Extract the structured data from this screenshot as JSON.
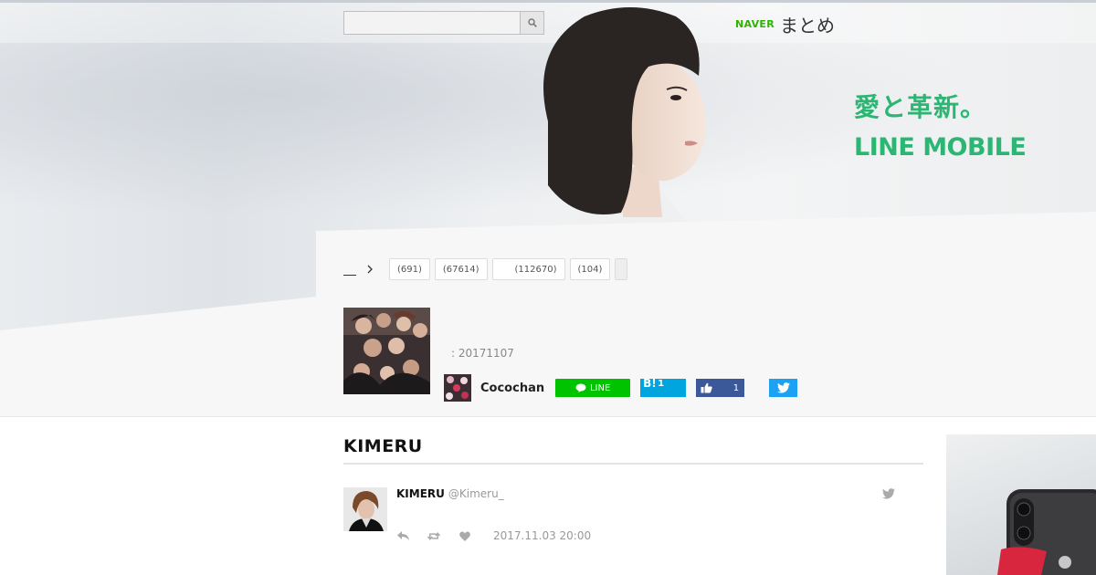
{
  "header": {
    "search": {
      "value": "",
      "placeholder": ""
    },
    "logo": {
      "brand": "NAVER",
      "service": "まとめ"
    }
  },
  "ad_banner": {
    "line1": "愛と革新。",
    "line2": "LINE MOBILE",
    "accent": "#2bb673"
  },
  "breadcrumb": {
    "home_label": "",
    "chips": [
      {
        "label": "(691)"
      },
      {
        "label": "(67614)"
      },
      {
        "label": "(112670)"
      },
      {
        "label": "(104)"
      }
    ]
  },
  "article": {
    "date_label": ": 20171107",
    "author": "Cocochan",
    "share": {
      "line_label": "LINE",
      "hatena_count": "1",
      "like_count": "1"
    }
  },
  "section": {
    "title": "KIMERU"
  },
  "tweet": {
    "name": "KIMERU",
    "handle": "@Kimeru_",
    "timestamp": "2017.11.03 20:00"
  },
  "colors": {
    "naver_green": "#2db400",
    "line_green": "#00c300",
    "hatena_blue": "#00a4de",
    "facebook_blue": "#3b5998",
    "twitter_blue": "#1da1f2"
  }
}
